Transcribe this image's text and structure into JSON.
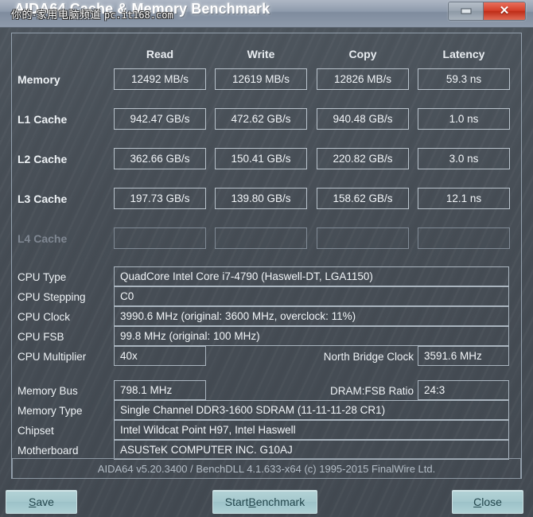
{
  "window": {
    "title": "AIDA64 Cache & Memory Benchmark",
    "watermark_cn": "你的·家用电脑频道",
    "watermark_site": "pc.it168.com",
    "minimize_icon": "minimize-icon",
    "close_icon": "close-icon",
    "accent_close": "#d4412b",
    "accent_button": "#a4c8cd",
    "background": "#474e56"
  },
  "benchmark_table": {
    "columns": [
      "Read",
      "Write",
      "Copy",
      "Latency"
    ],
    "rows": [
      {
        "label": "Memory",
        "disabled": false,
        "values": [
          "12492 MB/s",
          "12619 MB/s",
          "12826 MB/s",
          "59.3 ns"
        ]
      },
      {
        "label": "L1 Cache",
        "disabled": false,
        "values": [
          "942.47 GB/s",
          "472.62 GB/s",
          "940.48 GB/s",
          "1.0 ns"
        ]
      },
      {
        "label": "L2 Cache",
        "disabled": false,
        "values": [
          "362.66 GB/s",
          "150.41 GB/s",
          "220.82 GB/s",
          "3.0 ns"
        ]
      },
      {
        "label": "L3 Cache",
        "disabled": false,
        "values": [
          "197.73 GB/s",
          "139.80 GB/s",
          "158.62 GB/s",
          "12.1 ns"
        ]
      },
      {
        "label": "L4 Cache",
        "disabled": true,
        "values": [
          "",
          "",
          "",
          ""
        ]
      }
    ]
  },
  "cpu_info": {
    "cpu_type": {
      "label": "CPU Type",
      "value": "QuadCore Intel Core i7-4790  (Haswell-DT, LGA1150)"
    },
    "cpu_stepping": {
      "label": "CPU Stepping",
      "value": "C0"
    },
    "cpu_clock": {
      "label": "CPU Clock",
      "value": "3990.6 MHz  (original: 3600 MHz, overclock: 11%)"
    },
    "cpu_fsb": {
      "label": "CPU FSB",
      "value": "99.8 MHz  (original: 100 MHz)"
    },
    "cpu_multiplier": {
      "label": "CPU Multiplier",
      "value": "40x"
    },
    "north_bridge_clock": {
      "label": "North Bridge Clock",
      "value": "3591.6 MHz"
    }
  },
  "memory_info": {
    "memory_bus": {
      "label": "Memory Bus",
      "value": "798.1 MHz"
    },
    "dram_fsb_ratio": {
      "label": "DRAM:FSB Ratio",
      "value": "24:3"
    },
    "memory_type": {
      "label": "Memory Type",
      "value": "Single Channel DDR3-1600 SDRAM  (11-11-11-28 CR1)"
    },
    "chipset": {
      "label": "Chipset",
      "value": "Intel Wildcat Point H97, Intel Haswell"
    },
    "motherboard": {
      "label": "Motherboard",
      "value": "ASUSTeK COMPUTER INC. G10AJ"
    }
  },
  "footer": {
    "version_text": "AIDA64 v5.20.3400 / BenchDLL 4.1.633-x64  (c) 1995-2015 FinalWire Ltd."
  },
  "buttons": {
    "save": {
      "accel": "S",
      "rest": "ave"
    },
    "start_benchmark": {
      "pre": "Start ",
      "accel": "B",
      "rest": "enchmark"
    },
    "close": {
      "accel": "C",
      "rest": "lose"
    }
  }
}
